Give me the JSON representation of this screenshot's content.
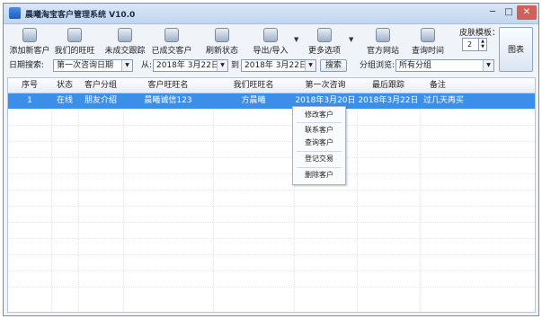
{
  "window": {
    "title": "晨曦淘宝客户管理系统 V10.0",
    "min": "─",
    "max": "□",
    "close": "✕"
  },
  "toolbar": {
    "buttons": [
      {
        "label": "添加新客户",
        "icon": "add-customer-icon"
      },
      {
        "label": "我们的旺旺",
        "icon": "wangwang-icon"
      },
      {
        "label": "未成交跟踪",
        "icon": "track-icon"
      },
      {
        "label": "已成交客户",
        "icon": "deal-icon"
      },
      {
        "label": "刷新状态",
        "icon": "refresh-icon"
      },
      {
        "label": "导出/导入",
        "icon": "export-icon"
      },
      {
        "label": "更多选项",
        "icon": "more-options-icon"
      },
      {
        "label": "官方网站",
        "icon": "website-icon"
      },
      {
        "label": "查询时间",
        "icon": "query-time-icon"
      }
    ],
    "skin_label": "皮肤模板：",
    "skin_value": "2",
    "chart_label": "图表"
  },
  "filters": {
    "date_search_label": "日期搜索:",
    "date_field": "第一次咨询日期",
    "from_label": "从:",
    "from_date": "2018年 3月22日",
    "to_label": "到",
    "to_date": "2018年 3月22日",
    "search_label": "搜索",
    "group_label": "分组浏览:",
    "group_value": "所有分组"
  },
  "table": {
    "columns": [
      "序号",
      "状态",
      "客户分组",
      "客户旺旺名",
      "我们旺旺名",
      "第一次咨询",
      "最后跟踪",
      "备注"
    ],
    "rows": [
      [
        "1",
        "在线",
        "朋友介绍",
        "晨曦诚信123",
        "方晨曦",
        "2018年3月20日",
        "2018年3月22日",
        "过几天再买"
      ]
    ]
  },
  "context_menu": {
    "items": [
      "修改客户",
      "联系客户",
      "查询客户",
      "登记交易",
      "删除客户"
    ]
  },
  "colors": {
    "selected_row": "#3c8fe8",
    "title_bar": "#c3d6f0"
  }
}
